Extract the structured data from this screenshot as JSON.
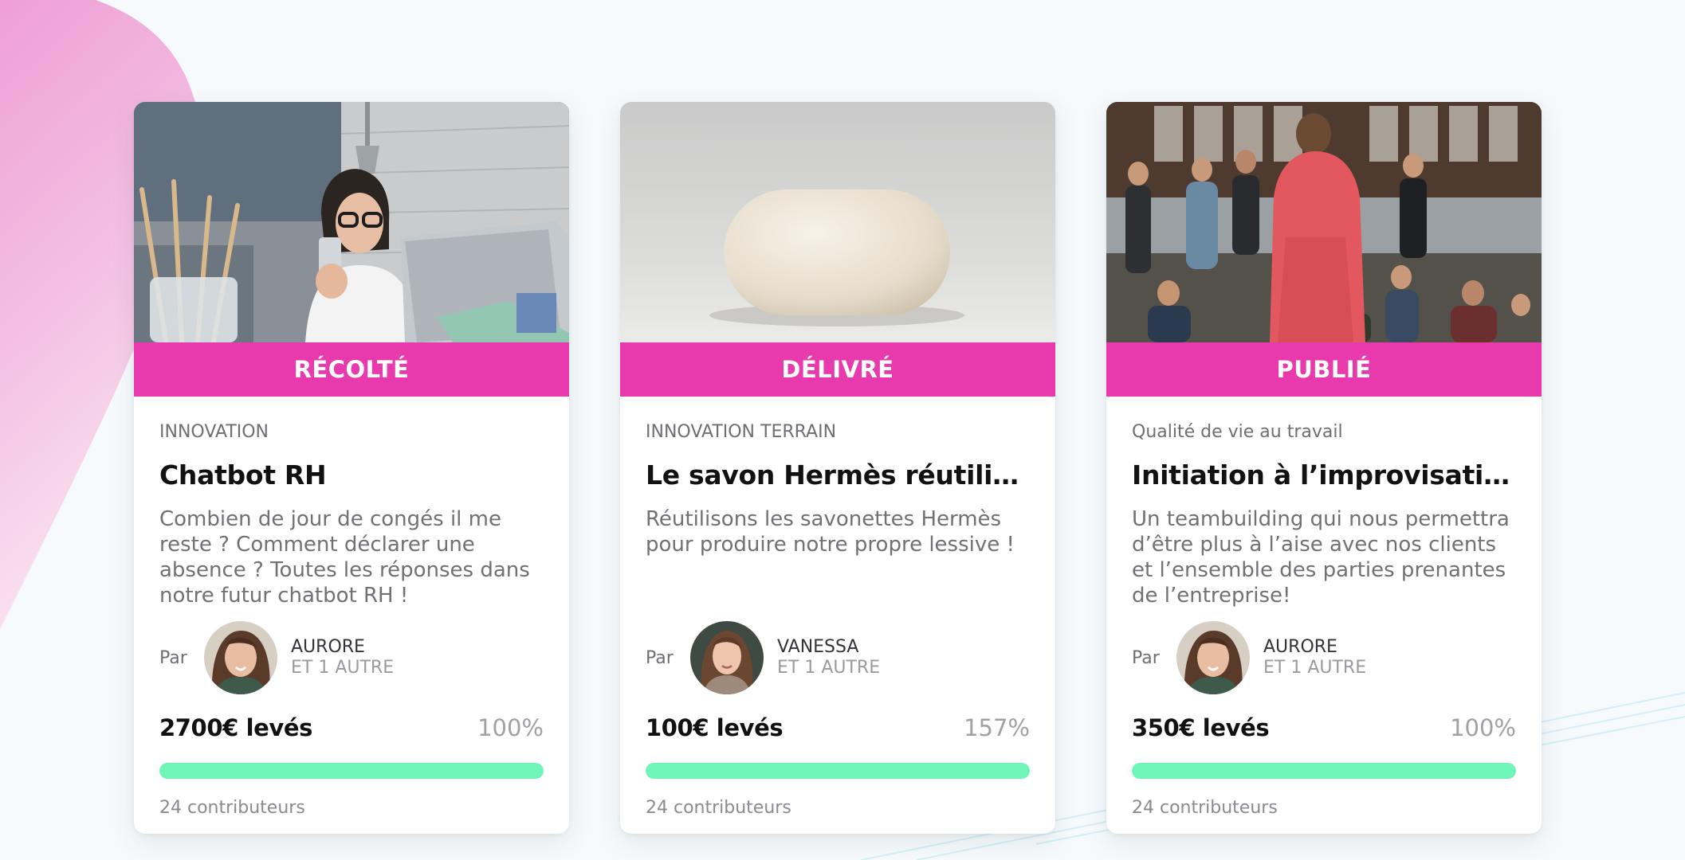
{
  "colors": {
    "accent_pink": "#e83aad",
    "progress_green": "#6ef5b7",
    "background": "#f6fafc"
  },
  "cards": [
    {
      "image_subject": "woman-with-phone-and-laptop",
      "status": "RÉCOLTÉ",
      "category": "INNOVATION",
      "title": "Chatbot RH",
      "description": "Combien de jour de congés il me reste ? Comment déclarer une absence ? Toutes les réponses dans notre futur chatbot RH !",
      "by_label": "Par",
      "author": "AURORE",
      "co_authors": "ET 1 AUTRE",
      "amount": "2700€ levés",
      "percent_label": "100%",
      "progress": 1.0,
      "contributors": "24 contributeurs"
    },
    {
      "image_subject": "white-soap-bar",
      "status": "DÉLIVRÉ",
      "category": "INNOVATION TERRAIN",
      "title": "Le savon Hermès réutilisé e…",
      "description": "Réutilisons les savonettes Hermès pour produire notre propre lessive !",
      "by_label": "Par",
      "author": "VANESSA",
      "co_authors": "ET 1 AUTRE",
      "amount": "100€ levés",
      "percent_label": "157%",
      "progress": 1.0,
      "contributors": "24 contributeurs"
    },
    {
      "image_subject": "group-improv-workshop",
      "status": "PUBLIÉ",
      "category": "Qualité de vie au travail",
      "title": "Initiation à l’improvisation",
      "description": "Un teambuilding qui nous permettra d’être plus à l’aise avec nos clients et l’ensemble des parties prenantes de l’entreprise!",
      "by_label": "Par",
      "author": "AURORE",
      "co_authors": "ET 1 AUTRE",
      "amount": "350€ levés",
      "percent_label": "100%",
      "progress": 1.0,
      "contributors": "24 contributeurs"
    }
  ]
}
